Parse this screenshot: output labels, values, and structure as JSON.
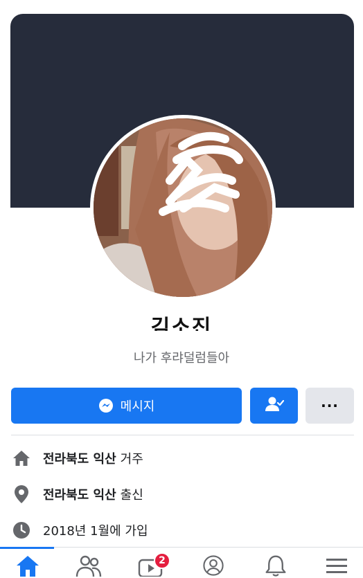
{
  "profile": {
    "name": "김소진",
    "bio": "나가 후랴덜럼들아"
  },
  "actions": {
    "message_label": "메시지",
    "more_label": "···"
  },
  "info": [
    {
      "bold": "전라북도 익산",
      "suffix": "거주",
      "icon": "home-icon"
    },
    {
      "bold": "전라북도 익산",
      "suffix": "출신",
      "icon": "location-pin-icon"
    },
    {
      "bold": "",
      "suffix": "2018년 1월에 가입",
      "icon": "clock-icon"
    }
  ],
  "nav": {
    "items": [
      "home-icon",
      "friends-icon",
      "watch-icon",
      "profile-icon",
      "notifications-icon",
      "menu-icon"
    ],
    "watch_badge": "2",
    "active": "home"
  },
  "colors": {
    "cover": "#262c3b",
    "accent": "#1877f2",
    "badge": "#e41e3f"
  }
}
